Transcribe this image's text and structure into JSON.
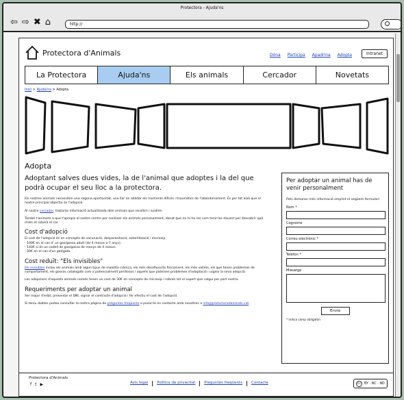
{
  "browser": {
    "window_title": "Protectora - Ajuda'ns",
    "url": "http://",
    "nav_icons": [
      "back-arrow-icon",
      "forward-arrow-icon",
      "close-x-icon",
      "home-icon"
    ]
  },
  "header": {
    "logo_text": "Protectora d'Animals",
    "top_links": [
      "Dóna",
      "Participa",
      "Apadrina",
      "Adopta"
    ],
    "intranet_label": "Intranet"
  },
  "menu": {
    "items": [
      "La Protectora",
      "Ajuda'ns",
      "Els animals",
      "Cercador",
      "Novetats"
    ],
    "active_index": 1,
    "active_color": "#a8cdf0"
  },
  "breadcrumb": {
    "items": [
      "Inici",
      "Ajuda'ns",
      "Adopta"
    ],
    "separator": ">"
  },
  "main": {
    "title": "Adopta",
    "lead": "Adoptant salves dues vides, la de l'animal que adoptes i la del que podrà ocupar el seu lloc a la protectora.",
    "p1": "Els nostres animals necessiten una segona oportunitat, una llar on oblidar els moments difícils i traumàtics de l'abandonament.  És per tot això que el nostre principal objectiu és l'adopció.",
    "p2_before": "Al nostre ",
    "p2_link": "cercador",
    "p2_after": ", trobaràs informació actualitzada dels animals que recollim i acollim.",
    "p3": "També t'animem a que t'apropis al nostre centre per conèixer els animals personalment, donat que no hi ha res com tenir-los davant per descobrir què d'ells et robarà el cor.",
    "h_cost": "Cost d'adopció",
    "cost_intro": "El cost de l'adopció és en concepte de vacunació, desparasitació, esterilització i microxip.",
    "cost_items": [
      "- 100€ en el cas d' un gos/gossa adult (de 4 mesos a 7 anys).",
      "- 140€ si és un cadell de gos/gossa de menys de 4 mesos.",
      "- 50€ en el cas d'un gat/gata."
    ],
    "h_reduced": "Cost reduït: \"Els invisibles\"",
    "reduced_link": "Els invisibles",
    "reduced_text": " inclou els animals amb algun tipus de malaltia crònica, els més desafavorits físicament, els més vellets, els que tenen problemes de comportament, els gossos catalogats com a potencialment perillosos i aquells que pateixen problemes d'adaptació i urgeix la seva adopció.",
    "reduced_p2": "Les adopcions d'aquests animals només tenen un cost de 30€ en concepte de microxip i rebran tot el suport que calgui per part nostra.",
    "h_req": "Requeriments per adoptar un animal",
    "req_text": "Ser major d'edat, presentar el DNI, signar el contracte d'adopció i fer efectiu el cost de l'adopció.",
    "faq_before": "Si teniu dubtes podeu consultar la nostra pàgina de ",
    "faq_link": "preguntes freqüents",
    "faq_after": " o posar-te en contacte amb nosaltres a ",
    "email_link": "info@protectoradanimals.cat",
    "faq_end": "."
  },
  "form": {
    "title": "Per adoptar un animal has de venir personalment",
    "intro": "Pots demanar més informació omplint el següent formulari:",
    "labels": [
      "Nom *",
      "Cognoms",
      "Correu electrònic *",
      "Telèfon *",
      "Missatge"
    ],
    "send_label": "Envia",
    "required_note": "* Indica camp obligatori"
  },
  "footer": {
    "name": "Protectora d'Animals",
    "social_icons": [
      "facebook-icon",
      "twitter-icon",
      "youtube-icon"
    ],
    "links": [
      "Avís legal",
      "Política de privacitat",
      "Preguntes freqüents",
      "Contacte"
    ],
    "license": "BY - NC - ND",
    "license_icon": "cc"
  }
}
